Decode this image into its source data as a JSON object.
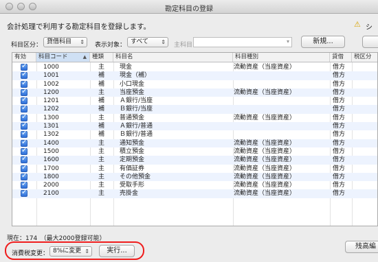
{
  "window": {
    "title": "勘定科目の登録"
  },
  "headline": "会計処理で利用する勘定科目を登録します。",
  "notice": {
    "text": "シ"
  },
  "filters": {
    "category_label": "科目区分：",
    "category_value": "貸借科目",
    "display_label": "表示対象：",
    "display_value": "すべて",
    "main_account_label": "主科目"
  },
  "buttons": {
    "new": "新規...",
    "execute": "実行...",
    "balance_edit": "残高編"
  },
  "table": {
    "columns": [
      "有効",
      "科目コード",
      "種類",
      "科目名",
      "科目種別",
      "貸借",
      "税区分"
    ],
    "rows": [
      {
        "code": "1000",
        "kind": "主",
        "name": "現金",
        "type": "流動資産（当座資産）",
        "dc": "借方"
      },
      {
        "code": "1001",
        "kind": "補",
        "name": "現金（補）",
        "type": "",
        "dc": "借方"
      },
      {
        "code": "1002",
        "kind": "補",
        "name": "小口現金",
        "type": "",
        "dc": "借方"
      },
      {
        "code": "1200",
        "kind": "主",
        "name": "当座預金",
        "type": "流動資産（当座資産）",
        "dc": "借方"
      },
      {
        "code": "1201",
        "kind": "補",
        "name": "Ａ銀行/当座",
        "type": "",
        "dc": "借方"
      },
      {
        "code": "1202",
        "kind": "補",
        "name": "Ｂ銀行/当座",
        "type": "",
        "dc": "借方"
      },
      {
        "code": "1300",
        "kind": "主",
        "name": "普通預金",
        "type": "流動資産（当座資産）",
        "dc": "借方"
      },
      {
        "code": "1301",
        "kind": "補",
        "name": "Ａ銀行/普通",
        "type": "",
        "dc": "借方"
      },
      {
        "code": "1302",
        "kind": "補",
        "name": "Ｂ銀行/普通",
        "type": "",
        "dc": "借方"
      },
      {
        "code": "1400",
        "kind": "主",
        "name": "通知預金",
        "type": "流動資産（当座資産）",
        "dc": "借方"
      },
      {
        "code": "1500",
        "kind": "主",
        "name": "積立預金",
        "type": "流動資産（当座資産）",
        "dc": "借方"
      },
      {
        "code": "1600",
        "kind": "主",
        "name": "定期預金",
        "type": "流動資産（当座資産）",
        "dc": "借方"
      },
      {
        "code": "1700",
        "kind": "主",
        "name": "有価証券",
        "type": "流動資産（当座資産）",
        "dc": "借方"
      },
      {
        "code": "1800",
        "kind": "主",
        "name": "その他預金",
        "type": "流動資産（当座資産）",
        "dc": "借方"
      },
      {
        "code": "2000",
        "kind": "主",
        "name": "受取手形",
        "type": "流動資産（当座資産）",
        "dc": "借方"
      },
      {
        "code": "2100",
        "kind": "主",
        "name": "売掛金",
        "type": "流動資産（当座資産）",
        "dc": "借方"
      }
    ]
  },
  "status": "現在：174　（最大2000登録可能）",
  "tax_change": {
    "label": "消費税変更：",
    "value": "8%に変更"
  }
}
